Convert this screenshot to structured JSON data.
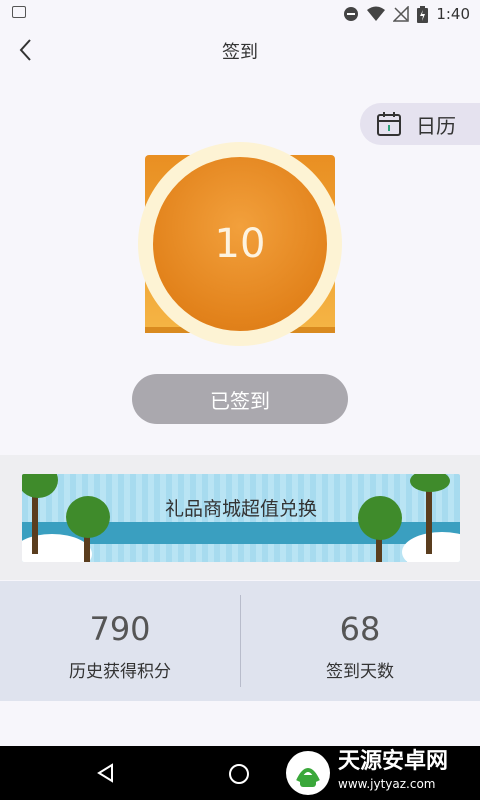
{
  "status_bar": {
    "time": "1:40"
  },
  "header": {
    "title": "签到",
    "back_icon": "chevron-left-icon"
  },
  "calendar": {
    "label": "日历",
    "icon": "calendar-icon"
  },
  "coin": {
    "value": "10"
  },
  "sign_button": {
    "label": "已签到"
  },
  "banner": {
    "text": "礼品商城超值兑换"
  },
  "stats": [
    {
      "value": "790",
      "label": "历史获得积分"
    },
    {
      "value": "68",
      "label": "签到天数"
    }
  ],
  "watermark": {
    "title": "天源安卓网",
    "url": "www.jytyaz.com"
  },
  "colors": {
    "accent_orange": "#e2821b",
    "pill_bg": "#e5e2ef",
    "stats_bg": "#dfe3ee",
    "disabled_button": "#aaa8ae"
  }
}
